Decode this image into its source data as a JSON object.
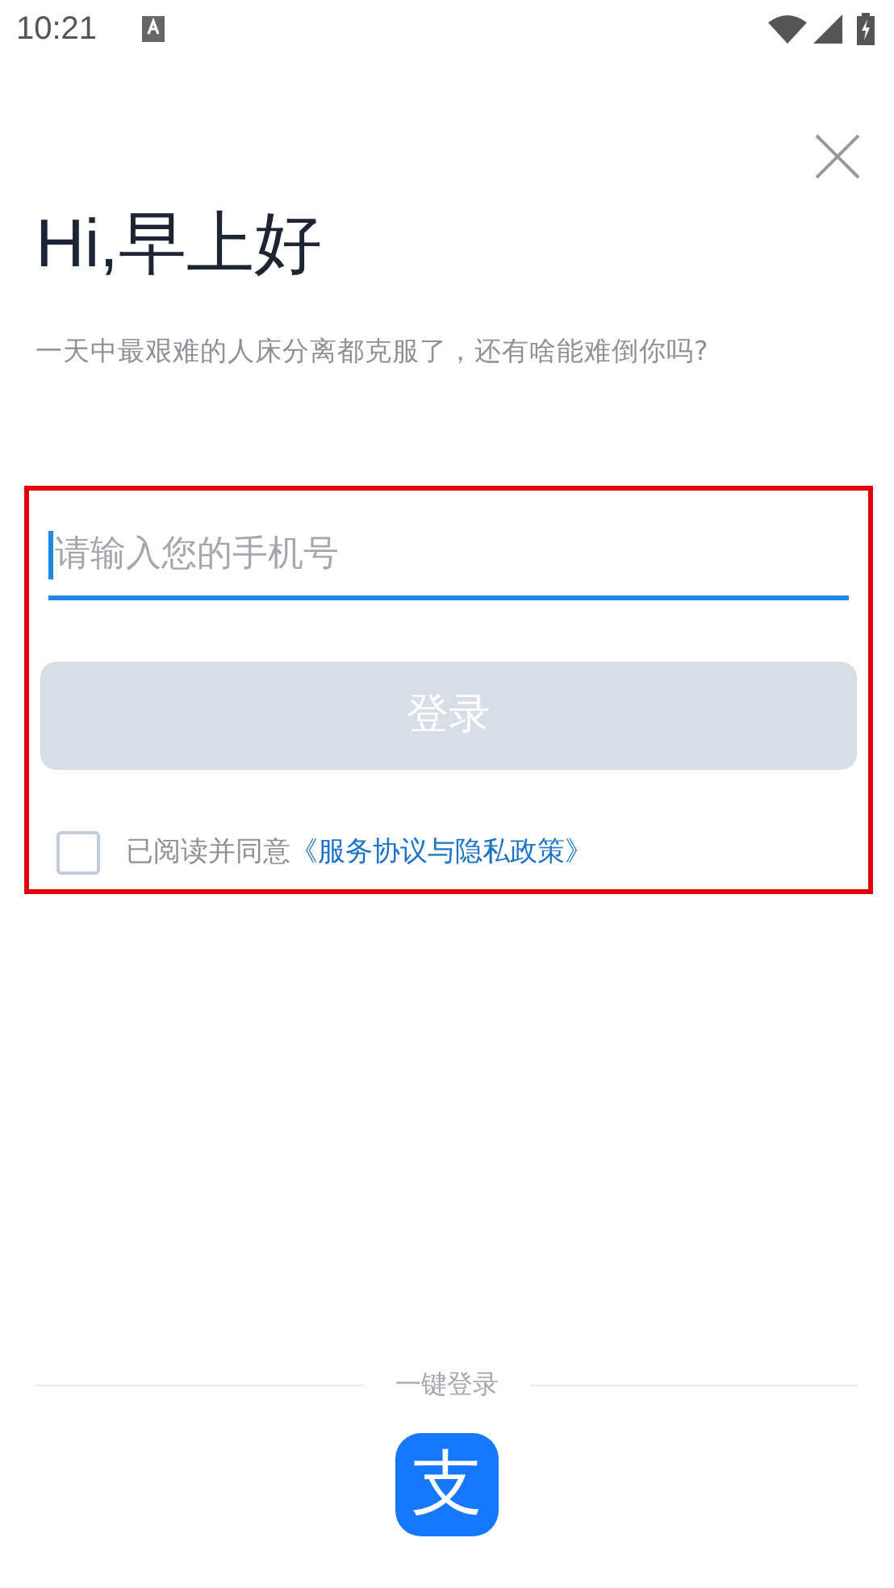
{
  "status_bar": {
    "time": "10:21"
  },
  "greeting": "Hi,早上好",
  "subtitle": "一天中最艰难的人床分离都克服了，还有啥能难倒你吗?",
  "phone_field": {
    "placeholder": "请输入您的手机号",
    "focused": true
  },
  "login_button": {
    "label": "登录",
    "disabled": true
  },
  "agreement": {
    "checked": false,
    "text": "已阅读并同意",
    "link": "《服务协议与隐私政策》"
  },
  "quick_login": {
    "label": "一键登录",
    "logo_text": "支"
  },
  "highlight": true
}
